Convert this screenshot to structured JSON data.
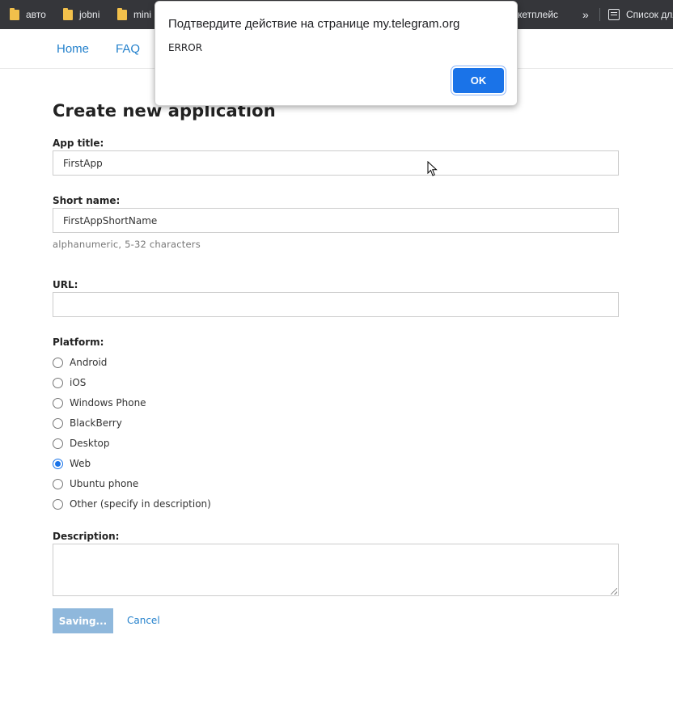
{
  "bookmarks": {
    "items": [
      "авто",
      "jobni",
      "mini"
    ],
    "partial_item": "кетплейс",
    "overflow_glyph": "»",
    "reading_list": "Список для"
  },
  "nav": {
    "home": "Home",
    "faq": "FAQ"
  },
  "form": {
    "title": "Create new application",
    "app_title_label": "App title:",
    "app_title_value": "FirstApp",
    "short_name_label": "Short name:",
    "short_name_value": "FirstAppShortName",
    "short_name_hint": "alphanumeric, 5-32 characters",
    "url_label": "URL:",
    "url_value": "",
    "platform_label": "Platform:",
    "platforms": [
      {
        "label": "Android",
        "checked": false
      },
      {
        "label": "iOS",
        "checked": false
      },
      {
        "label": "Windows Phone",
        "checked": false
      },
      {
        "label": "BlackBerry",
        "checked": false
      },
      {
        "label": "Desktop",
        "checked": false
      },
      {
        "label": "Web",
        "checked": true
      },
      {
        "label": "Ubuntu phone",
        "checked": false
      },
      {
        "label": "Other (specify in description)",
        "checked": false
      }
    ],
    "description_label": "Description:",
    "description_value": "",
    "save_label": "Saving...",
    "cancel_label": "Cancel"
  },
  "dialog": {
    "title": "Подтвердите действие на странице my.telegram.org",
    "message": "ERROR",
    "ok_label": "OK"
  },
  "colors": {
    "link": "#2481cc",
    "accent": "#1a73e8",
    "save_disabled": "#8fb8dc",
    "bookmarks_bg": "#35363a"
  }
}
